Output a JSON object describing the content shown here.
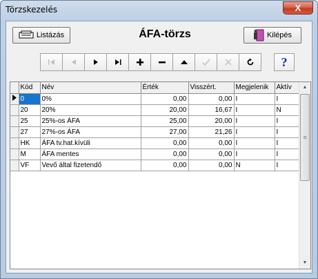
{
  "window": {
    "title": "Törzskezelés",
    "close_glyph": "X"
  },
  "header": {
    "listazas_label": "Listázás",
    "kilepes_label": "Kilépés",
    "page_title": "ÁFA-törzs"
  },
  "navigator": {
    "buttons": [
      "first",
      "prior",
      "next",
      "last",
      "insert",
      "delete",
      "edit",
      "post",
      "cancel",
      "refresh"
    ],
    "help_label": "?"
  },
  "grid": {
    "columns": [
      "Kód",
      "Név",
      "Érték",
      "Visszért.",
      "Megjelenik",
      "Aktív"
    ],
    "rows": [
      [
        "0",
        "0%",
        "0,00",
        "0,00",
        "I",
        "I"
      ],
      [
        "20",
        "20%",
        "20,00",
        "16,67",
        "I",
        "N"
      ],
      [
        "25",
        "25%-os ÁFA",
        "25,00",
        "20,00",
        "I",
        "I"
      ],
      [
        "27",
        "27%-os ÁFA",
        "27,00",
        "21,26",
        "I",
        "I"
      ],
      [
        "HK",
        "ÁFA tv.hat.kívüli",
        "0,00",
        "0,00",
        "I",
        "I"
      ],
      [
        "M",
        "ÁFA mentes",
        "0,00",
        "0,00",
        "I",
        "I"
      ],
      [
        "VF",
        "Vevő által fizetendő",
        "0,00",
        "0,00",
        "N",
        "I"
      ]
    ],
    "selected_row": 0
  },
  "colors": {
    "selection": "#1874cd",
    "help_icon": "#1432a8"
  }
}
